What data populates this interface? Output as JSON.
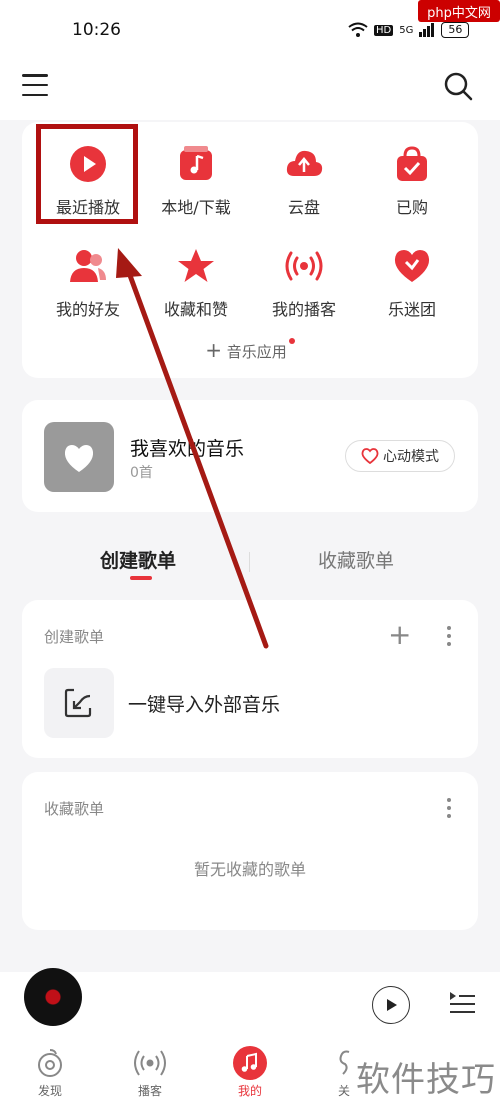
{
  "status_bar": {
    "time": "10:26",
    "network": "HD",
    "signal": "5G",
    "battery": "56"
  },
  "watermark_top": "php中文网",
  "grid": {
    "items": [
      {
        "label": "最近播放",
        "icon": "play-circle-icon"
      },
      {
        "label": "本地/下载",
        "icon": "music-note-icon"
      },
      {
        "label": "云盘",
        "icon": "cloud-upload-icon"
      },
      {
        "label": "已购",
        "icon": "shopping-bag-icon"
      },
      {
        "label": "我的好友",
        "icon": "friends-icon"
      },
      {
        "label": "收藏和赞",
        "icon": "star-icon"
      },
      {
        "label": "我的播客",
        "icon": "broadcast-icon"
      },
      {
        "label": "乐迷团",
        "icon": "heart-fan-icon"
      }
    ],
    "music_app": "音乐应用"
  },
  "favorite": {
    "title": "我喜欢的音乐",
    "count": "0首",
    "heart_mode": "心动模式"
  },
  "tabs": {
    "created": "创建歌单",
    "collected": "收藏歌单"
  },
  "created_section": {
    "title": "创建歌单",
    "import_label": "一键导入外部音乐"
  },
  "collected_section": {
    "title": "收藏歌单",
    "empty": "暂无收藏的歌单"
  },
  "nav": [
    {
      "label": "发现",
      "icon": "discover-icon"
    },
    {
      "label": "播客",
      "icon": "podcast-icon"
    },
    {
      "label": "我的",
      "icon": "my-music-icon"
    },
    {
      "label": "关",
      "icon": "follow-icon"
    }
  ],
  "watermark_bottom": "软件技巧",
  "colors": {
    "accent": "#e8343b",
    "highlight": "#b01010"
  }
}
